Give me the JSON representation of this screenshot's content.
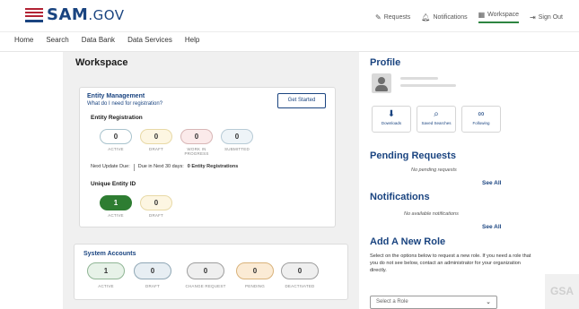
{
  "header": {
    "logo_text": "SAM",
    "logo_suffix": ".GOV",
    "links": [
      {
        "label": "Requests",
        "icon": "edit-icon"
      },
      {
        "label": "Notifications",
        "icon": "bell-icon"
      },
      {
        "label": "Workspace",
        "icon": "grid-icon"
      },
      {
        "label": "Sign Out",
        "icon": "signout-icon"
      }
    ]
  },
  "nav": {
    "items": [
      "Home",
      "Search",
      "Data Bank",
      "Data Services",
      "Help"
    ]
  },
  "workspace": {
    "title": "Workspace",
    "entity_management": {
      "title": "Entity Management",
      "help_link": "What do I need for registration?",
      "get_started": "Get Started",
      "registration_title": "Entity Registration",
      "statuses": [
        {
          "count": "0",
          "label": "ACTIVE"
        },
        {
          "count": "0",
          "label": "DRAFT"
        },
        {
          "count": "0",
          "label": "WORK IN PROGRESS"
        },
        {
          "count": "0",
          "label": "SUBMITTED"
        }
      ],
      "next_update": "Next Update Due:",
      "due_text": "Due in Next 30 days:",
      "due_value": "0 Entity Registrations",
      "uei_title": "Unique Entity ID",
      "uei": [
        {
          "count": "1",
          "label": "ACTIVE"
        },
        {
          "count": "0",
          "label": "DRAFT"
        }
      ]
    },
    "system_accounts": {
      "title": "System Accounts",
      "statuses": [
        {
          "count": "1",
          "label": "ACTIVE"
        },
        {
          "count": "0",
          "label": "DRAFT"
        },
        {
          "count": "0",
          "label": "CHANGE REQUEST"
        },
        {
          "count": "0",
          "label": "PENDING"
        },
        {
          "count": "0",
          "label": "DEACTIVATED"
        }
      ]
    }
  },
  "profile": {
    "title": "Profile",
    "tiles": [
      {
        "label": "Downloads",
        "icon": "download-icon"
      },
      {
        "label": "Saved Searches",
        "icon": "saved-search-icon"
      },
      {
        "label": "Following",
        "icon": "binoculars-icon"
      }
    ]
  },
  "pending_requests": {
    "title": "Pending Requests",
    "empty": "No pending requests",
    "see_all": "See All"
  },
  "notifications": {
    "title": "Notifications",
    "empty": "No available notifications",
    "see_all": "See All"
  },
  "add_role": {
    "title": "Add A New Role",
    "text": "Select on the options below to request a new role. If you need a role that you do not see below, contact an administrator for your organization directly.",
    "select_placeholder": "Select a Role"
  },
  "watermark": "GSA"
}
